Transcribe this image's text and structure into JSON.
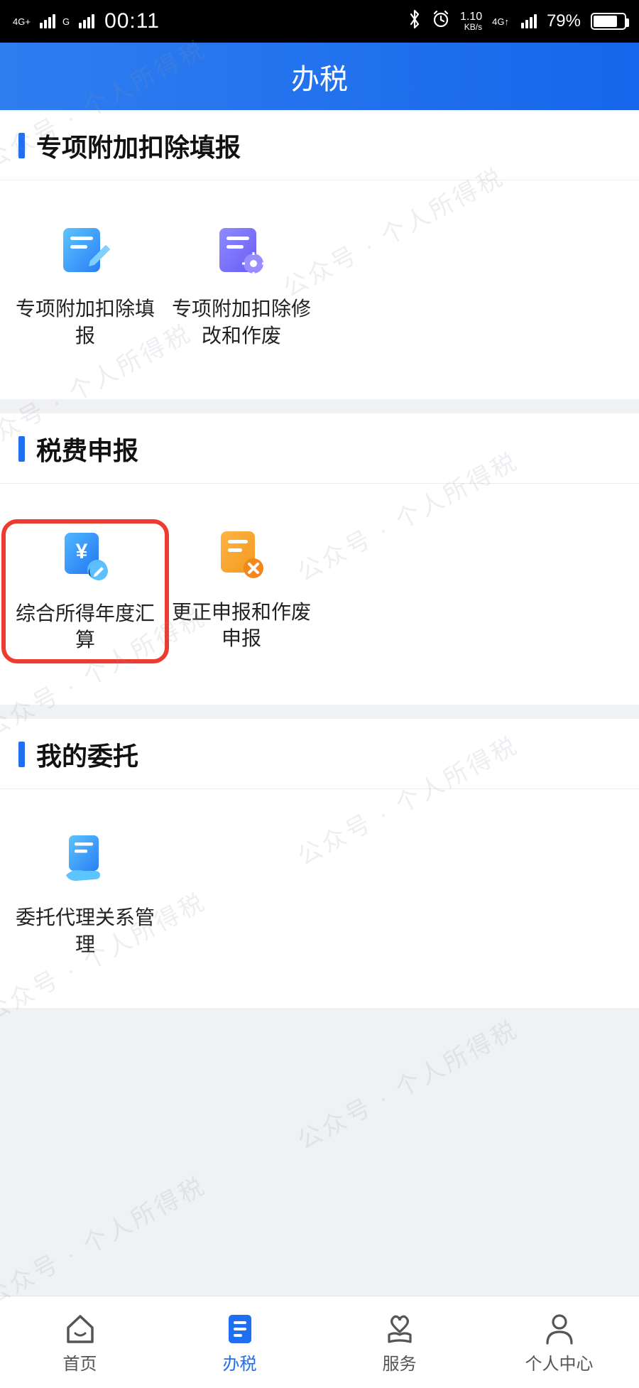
{
  "status": {
    "net_label_1": "4G+",
    "net_label_2": "G",
    "time": "00:11",
    "data_rate_value": "1.10",
    "data_rate_unit": "KB/s",
    "signal_label": "4G↑",
    "battery_pct": "79%",
    "battery_fill_pct": 79
  },
  "header": {
    "title": "办税"
  },
  "sections": [
    {
      "title": "专项附加扣除填报",
      "items": [
        {
          "label": "专项附加扣除填报",
          "icon": "doc-edit-blue"
        },
        {
          "label": "专项附加扣除修改和作废",
          "icon": "doc-gear-purple"
        }
      ]
    },
    {
      "title": "税费申报",
      "items": [
        {
          "label": "综合所得年度汇算",
          "icon": "doc-yen-blue",
          "highlighted": true
        },
        {
          "label": "更正申报和作废申报",
          "icon": "doc-cancel-orange"
        }
      ]
    },
    {
      "title": "我的委托",
      "items": [
        {
          "label": "委托代理关系管理",
          "icon": "doc-hand-blue"
        }
      ]
    }
  ],
  "nav": {
    "items": [
      {
        "label": "首页",
        "icon": "home"
      },
      {
        "label": "办税",
        "icon": "doc",
        "active": true
      },
      {
        "label": "服务",
        "icon": "heart"
      },
      {
        "label": "个人中心",
        "icon": "person"
      }
    ]
  },
  "watermark_text": "公众号 · 个人所得税"
}
